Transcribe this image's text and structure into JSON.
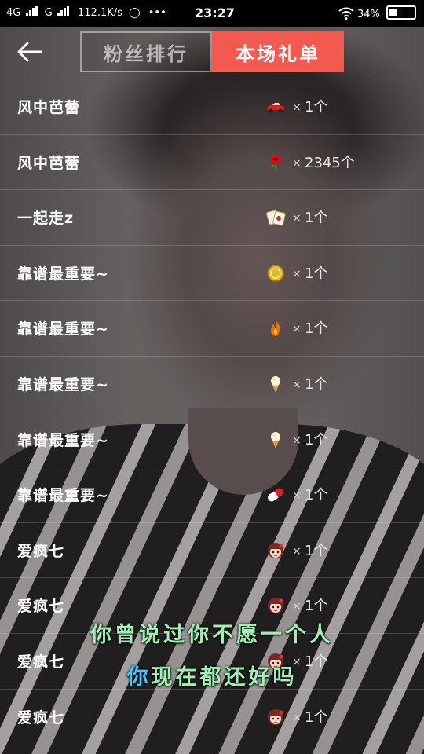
{
  "status_bar": {
    "network1": "4G",
    "network2": "G",
    "speed": "112.1K/s",
    "more": "•••",
    "time": "23:27",
    "battery_percent": "34%",
    "battery_level": 0.34
  },
  "header": {
    "back_icon": "back-arrow-icon",
    "tabs": [
      {
        "label": "粉丝排行",
        "active": false
      },
      {
        "label": "本场礼单",
        "active": true
      }
    ]
  },
  "gifts": [
    {
      "name": "风中芭蕾",
      "gift_icon": "sports-car-icon",
      "x": "×",
      "quantity": "1个"
    },
    {
      "name": "风中芭蕾",
      "gift_icon": "rose-icon",
      "x": "×",
      "quantity": "2345个"
    },
    {
      "name": "一起走z",
      "gift_icon": "mahjong-icon",
      "x": "×",
      "quantity": "1个"
    },
    {
      "name": "靠谱最重要~",
      "gift_icon": "gold-coin-icon",
      "x": "×",
      "quantity": "1个"
    },
    {
      "name": "靠谱最重要~",
      "gift_icon": "fire-icon",
      "x": "×",
      "quantity": "1个"
    },
    {
      "name": "靠谱最重要~",
      "gift_icon": "ice-cream-icon",
      "x": "×",
      "quantity": "1个"
    },
    {
      "name": "靠谱最重要~",
      "gift_icon": "ice-cream-icon",
      "x": "×",
      "quantity": "1个"
    },
    {
      "name": "靠谱最重要~",
      "gift_icon": "capsule-pill-icon",
      "x": "×",
      "quantity": "1个"
    },
    {
      "name": "爱疯七",
      "gift_icon": "doll-face-icon",
      "x": "×",
      "quantity": "1个"
    },
    {
      "name": "爱疯七",
      "gift_icon": "doll-face-icon",
      "x": "×",
      "quantity": "1个"
    },
    {
      "name": "爱疯七",
      "gift_icon": "doll-face-icon",
      "x": "×",
      "quantity": "1个"
    },
    {
      "name": "爱疯七",
      "gift_icon": "doll-face-icon",
      "x": "×",
      "quantity": "1个"
    }
  ],
  "lyrics": {
    "line1": "你曾说过你不愿一个人",
    "line2_highlight": "你",
    "line2_rest": "现在都还好吗"
  },
  "colors": {
    "active_tab": "#f25a4f",
    "lyric_green": "#9ff0b4",
    "lyric_highlight": "#38c8ff"
  }
}
